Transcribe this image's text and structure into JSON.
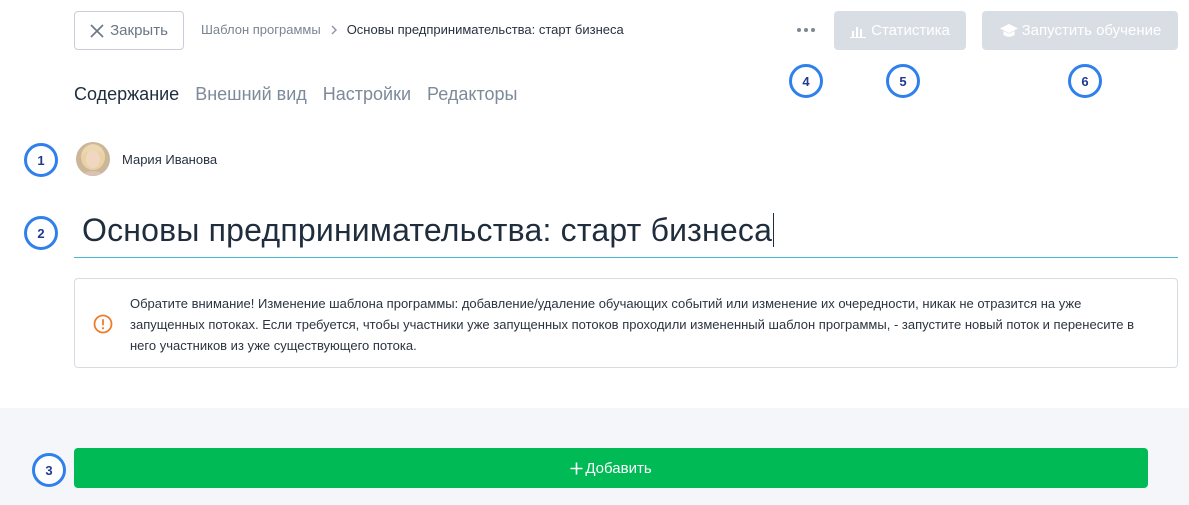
{
  "header": {
    "close_label": "Закрыть",
    "breadcrumb": {
      "parent": "Шаблон программы",
      "current": "Основы предпринимательства: старт бизнеса"
    },
    "more_icon": "more-horizontal-icon",
    "statistics_label": "Статистика",
    "launch_label": "Запустить обучение"
  },
  "tabs": [
    {
      "label": "Содержание",
      "active": true
    },
    {
      "label": "Внешний вид",
      "active": false
    },
    {
      "label": "Настройки",
      "active": false
    },
    {
      "label": "Редакторы",
      "active": false
    }
  ],
  "author": {
    "name": "Мария Иванова"
  },
  "title_field": {
    "value": "Основы предпринимательства: старт бизнеса"
  },
  "notice": {
    "text": "Обратите внимание! Изменение шаблона программы: добавление/удаление обучающих событий или изменение их очередности, никак не отразится на уже запущенных потоках. Если требуется, чтобы участники уже запущенных потоков проходили измененный шаблон программы, - запустите новый поток и перенесите в него участников из уже существующего потока.",
    "icon": "warning-circle-icon"
  },
  "add_button": {
    "label": "Добавить"
  },
  "markers": [
    "1",
    "2",
    "3",
    "4",
    "5",
    "6"
  ],
  "colors": {
    "add_button": "#00ba55",
    "disabled_button": "#d9dee4",
    "marker_ring": "#2f80ed",
    "title_underline": "#49b6d6",
    "warning": "#f07c2a"
  }
}
